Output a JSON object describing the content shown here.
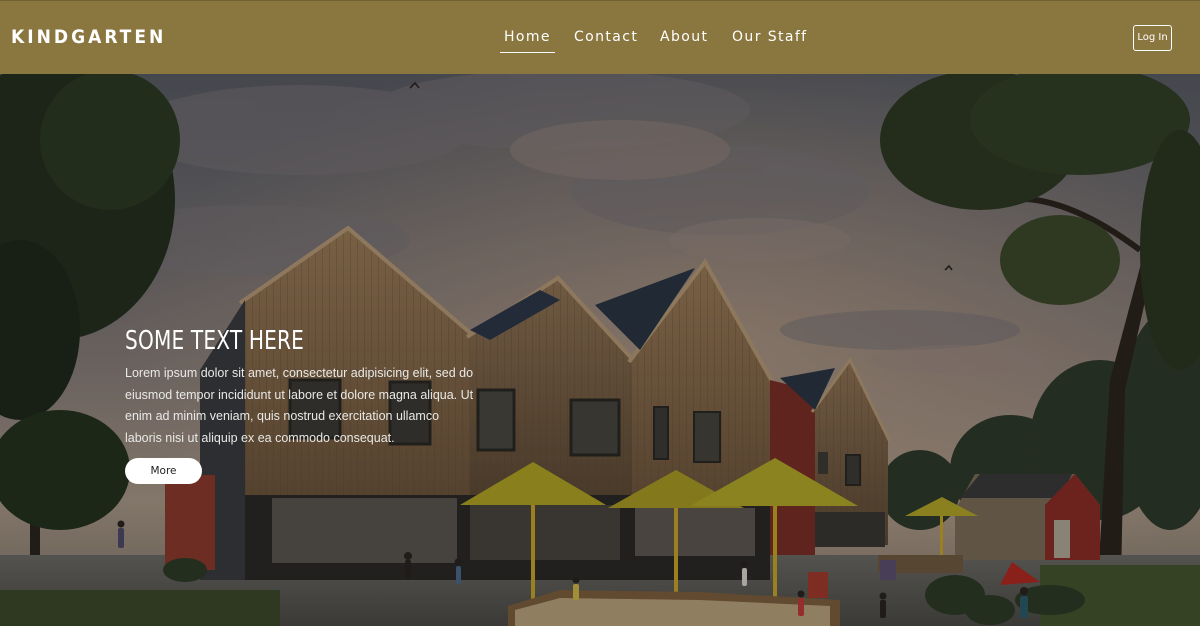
{
  "navbar": {
    "brand": "KINDGARTEN",
    "links": [
      {
        "label": "Home",
        "active": true
      },
      {
        "label": "Contact",
        "active": false
      },
      {
        "label": "About",
        "active": false
      },
      {
        "label": "Our Staff",
        "active": false
      }
    ],
    "login_label": "Log In"
  },
  "hero": {
    "heading": "SOME TEXT HERE",
    "body": "Lorem ipsum dolor sit amet, consectetur adipisicing elit, sed do eiusmod tempor incididunt ut labore et dolore magna aliqua. Ut enim ad minim veniam, quis nostrud exercitation ullamco laboris nisi ut aliquip ex ea commodo consequat.",
    "button_label": "More"
  },
  "colors": {
    "navbar_bg": "#8a763f",
    "nav_text": "#ffffff",
    "hero_text": "#ffffff",
    "button_bg": "#ffffff",
    "button_text": "#222222"
  },
  "icons": [
    "bird-icon"
  ]
}
